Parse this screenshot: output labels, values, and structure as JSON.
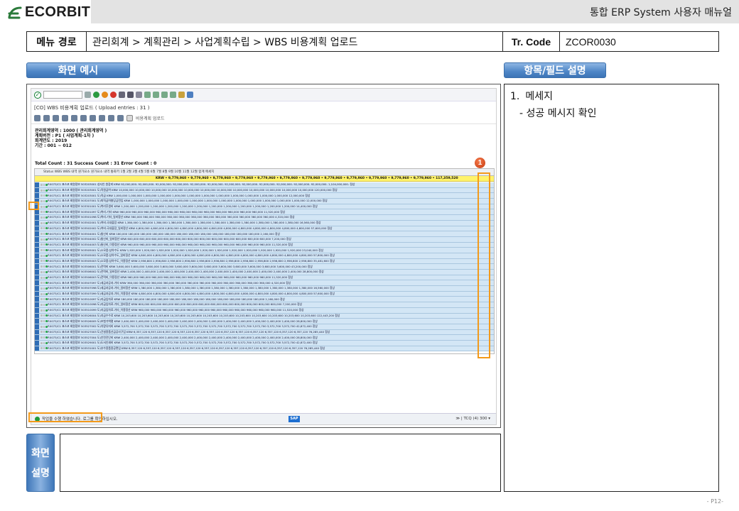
{
  "brand": {
    "logo_text": "ECORBIT"
  },
  "header": {
    "manual_title": "통합 ERP System 사용자 매뉴얼"
  },
  "menubar": {
    "path_label": "메뉴 경로",
    "path": "관리회계 > 계획관리 > 사업계획수립 > WBS 비용계획 업로드",
    "tr_label": "Tr. Code",
    "tr_code": "ZCOR0030"
  },
  "sections": {
    "screen_example": "화면 예시",
    "field_desc": "항목/필드 설명",
    "screen_desc_1": "화면",
    "screen_desc_2": "설명"
  },
  "sap": {
    "title": "[CO] WBS 비용계획 업로드 ( Upload entries : 31 )",
    "toolbar_text": "비용계획 업로드",
    "header_lines": [
      "관리회계영역 : 1000 (       관리회계영역 )",
      "계획버전 : P1 ( 사업계획-1차 )",
      "회계연도 : 2019",
      "기간 : 001 ~ 012"
    ],
    "total_line": "Total Count : 31  Success Count : 31  Error Count : 0",
    "grid_header": "Status  WBS      WBS 내역        원가요소       원가요소 내역         통화키     1월          2월          3월          4월          5월          6월          7월          8월          9월          10월         11월         12월           합계         메세지",
    "grid_total": "KRW  •  9,779,960 •  9,779,960 •  9,779,960 •  9,779,960 •  9,779,960 •  9,779,960 •  9,779,960 •  9,779,960 •  9,779,960 •  9,779,960 •  9,779,960 •  9,779,960 •  117,359,520",
    "rows": [
      "P.0073/C1  표스코 회원정보  503203001  성사인 원장비  KRW  92,000,000-  92,000,000-  92,000,000-  92,000,000-  92,000,000-  92,000,000-  92,000,000-  92,000,000-  92,000,000-  92,000,000-  92,000,000-  92,000,000-  1,104,000,000-  정상",
      "P.0073/C1  표스코 회원정보  503203001  도)직원급여  KRW  10,000,000  10,000,000  10,000,000  10,000,000  10,000,000  10,000,000  10,000,000  10,000,000  10,000,000  10,000,000  10,000,000  10,000,000  120,000,000  정상",
      "P.0073/C1  표스코 회원정보  503203001  도)직급  KRW  1,000,000  1,000,000  1,000,000  1,000,000  1,000,000  1,000,000  1,000,000  1,000,000  1,000,000  1,000,000  1,000,000  1,000,000  12,000,000  정상",
      "P.0073/C1  표스코 회원정보  503207001  도)퇴직급여충당금전입  KRW  1,000,000  1,000,000  1,000,000  1,000,000  1,000,000  1,000,000  1,000,000  1,000,000  1,000,000  1,000,000  1,000,000  1,000,000  12,000,000  정상",
      "P.0073/C1  표스코 회원정보  503301001  도)복리후생비  KRW  1,200,000  1,200,000  1,200,000  1,200,000  1,200,000  1,200,000  1,200,000  1,200,000  1,200,000  1,200,000  1,200,000  1,200,000  14,400,000  정상",
      "P.0073/C1  표스코 회원정보  503501097  도)복리-기타  KRW  960,000  960,000  960,000  960,000  960,000  960,000  960,000  960,000  960,000  960,000  960,000  960,000  11,520,000  정상",
      "P.0073/C1  표스코 회원정보  503501098  도)복리-기타_일비정산  KRW  360,000  360,000  360,000  360,000  360,000  360,000  360,000  360,000  360,000  360,000  360,000  360,000  4,320,000  정상",
      "P.0073/C1  표스코 회원정보  503502001  도)여비-국내출장  KRW  1,380,000  1,380,000  1,380,000  1,380,000  1,380,000  1,380,000  1,380,000  1,380,000  1,380,000  1,380,000  1,380,000  1,380,000  16,560,000  정상",
      "P.0073/C1  표스코 회원정보  503502002  도)여비-국내출장_일비정산  KRW  4,800,000  4,800,000  4,800,000  4,800,000  4,800,000  4,800,000  4,800,000  4,800,000  4,800,000  4,800,000  4,800,000  4,800,000  57,600,000  정상",
      "P.0073/C1  표스코 회원정보  503504001  도)통신비  KRW  180,000  180,000  180,000  180,000  180,000  180,000  180,000  180,000  180,000  180,000  180,000  180,000  2,160,000  정상",
      "P.0073/C1  표스코 회원정보  503504002  도)통신비_일비정산  KRW  600,000  600,000  600,000  600,000  600,000  600,000  600,000  600,000  600,000  600,000  600,000  600,000  7,200,000  정상",
      "P.0073/C1  표스코 회원정보  503504003  도)통신비_이용정산  KRW  960,000  960,000  960,000  960,000  960,000  960,000  960,000  960,000  960,000  960,000  960,000  960,000  11,520,000  정상",
      "P.0073/C1  표스코 회원정보  503505001  도)소모품:상하수도  KRW  1,920,000  1,920,000  1,920,000  1,920,000  1,920,000  1,920,000  1,920,000  1,920,000  1,920,000  1,920,000  1,920,000  1,920,000  23,040,000  정상",
      "P.0073/C1  표스코 회원정보  503505002  도)소모품:상하수도_일비정산  KRW  4,800,000  4,800,000  4,800,000  4,800,000  4,800,000  4,800,000  4,800,000  4,800,000  4,800,000  4,800,000  4,800,000  4,800,000  57,600,000  정상",
      "P.0073/C1  표스코 회원정보  503505003  도)소모품:상하수도_이용정산  KRW  2,956,800  2,956,800  2,956,800  2,956,800  2,956,800  2,956,800  2,956,800  2,956,800  2,956,800  2,956,800  2,956,800  2,956,800  35,481,600  정상",
      "P.0073/C1  표스코 회원정보  503506001  도)전력비  KRW  3,600,000  3,600,000  3,600,000  3,600,000  3,600,000  3,600,000  3,600,000  3,600,000  3,600,000  3,600,000  3,600,000  3,600,000  43,200,000  정상",
      "P.0073/C1  표스코 회원정보  503506002  도)전력비_일비정산  KRW  2,400,000  2,400,000  2,400,000  2,400,000  2,400,000  2,400,000  2,400,000  2,400,000  2,400,000  2,400,000  2,400,000  2,400,000  28,800,000  정상",
      "P.0073/C1  표스코 회원정보  503506003  도)전력비_이용정산  KRW  960,000  960,000  960,000  960,000  960,000  960,000  960,000  960,000  960,000  960,000  960,000  960,000  11,520,000  정상",
      "P.0073/C1  표스코 회원정보  503507097  도)세금과공과-기타  KRW  360,000  360,000  360,000  360,000  360,000  360,000  360,000  360,000  360,000  360,000  360,000  360,000  4,320,000  정상",
      "P.0073/C1  표스코 회원정보  503507098  도)세금과공과-기타_일비정산  KRW  1,380,000  1,380,000  1,380,000  1,380,000  1,380,000  1,380,000  1,380,000  1,380,000  1,380,000  1,380,000  1,380,000  1,380,000  16,560,000  정상",
      "P.0073/C1  표스코 회원정보  503507099  도)세금과공과-기타_이용정산  KRW  4,800,000  4,800,000  4,800,000  4,800,000  4,800,000  4,800,000  4,800,000  4,800,000  4,800,000  4,800,000  4,800,000  4,800,000  57,600,000  정상",
      "P.0073/C1  표스코 회원정보  503510097  도)지급임차료  KRW  180,000  180,000  180,000  180,000  180,000  180,000  180,000  180,000  180,000  180,000  180,000  180,000  2,160,000  정상",
      "P.0073/C1  표스코 회원정보  503510098  도)지급임차료-기타_일비정산  KRW  600,000  600,000  600,000  600,000  600,000  600,000  600,000  600,000  600,000  600,000  600,000  600,000  7,200,000  정상",
      "P.0073/C1  표스코 회원정보  503510099  도)지급임차료-기타_이용정산  KRW  960,000  960,000  960,000  960,000  960,000  960,000  960,000  960,000  960,000  960,000  960,000  960,000  11,520,000  정상",
      "P.0073/C1  표스코 회원정보  503526004  도)지급수수료  KRW  10,203,600  10,203,600  10,203,600  10,203,600  10,203,600  10,203,600  10,203,600  10,203,600  10,203,600  10,203,600  10,203,600  10,203,600  122,443,200  정상",
      "P.0073/C1  표스코 회원정보  503526005  도)보험가액평  KRW  2,400,000  2,400,000  2,400,000  2,400,000  2,400,000  2,400,000  2,400,000  2,400,000  2,400,000  2,400,000  2,400,000  2,400,000  28,800,000  정상",
      "P.0073/C1  표스코 회원정보  503527002  도)차량유지비  KRW  3,572,700  3,572,700  3,572,700  3,572,700  3,572,700  3,572,700  3,572,700  3,572,700  3,572,700  3,572,700  3,572,700  3,572,700  42,872,400  정상",
      "P.0073/C1  표스코 회원정보  503527003  도)건설용품선급공사구입  KRW  6,357,120  6,357,120  6,357,120  6,357,120  6,357,120  6,357,120  6,357,120  6,357,120  6,357,120  6,357,120  6,357,120  6,357,120  76,285,440  정상",
      "P.0073/C1  표스코 회원정보  503527004  도)안전진단비  KRW  2,400,000  2,400,000  2,400,000  2,400,000  2,400,000  2,400,000  2,400,000  2,400,000  2,400,000  2,400,000  2,400,000  2,400,000  28,800,000  정상",
      "P.0073/C1  표스코 회원정보  503529001  도)도서인쇄비  KRW  3,572,700  3,572,700  3,572,700  3,572,700  3,572,700  3,572,700  3,572,700  3,572,700  3,572,700  3,572,700  3,572,700  3,572,700  42,872,400  정상",
      "P.0073/C1  표스코 회원정보  503531001  도)부수용품용공편입  KRW  6,357,120  6,357,120  6,357,120  6,357,120  6,357,120  6,357,120  6,357,120  6,357,120  6,357,120  6,357,120  6,357,120  6,357,120  76,285,440  정상"
    ],
    "status_msg": "작업을 수행 하였습니다. 로그를 확인하십시오.",
    "sap_logo": "SAP",
    "system": "≫ | TCQ (4) 300 ▾"
  },
  "badge_number": "1",
  "field_panel": {
    "items": [
      {
        "num": "1.",
        "title": "메세지",
        "sub": "- 성공 메시지 확인"
      }
    ]
  },
  "page_number": "- P12-",
  "colors": {
    "accent_blue": "#4d85c6",
    "highlight_orange": "#f39a1b",
    "grid_row": "#d3e6f5",
    "grid_total": "#fff36b"
  }
}
